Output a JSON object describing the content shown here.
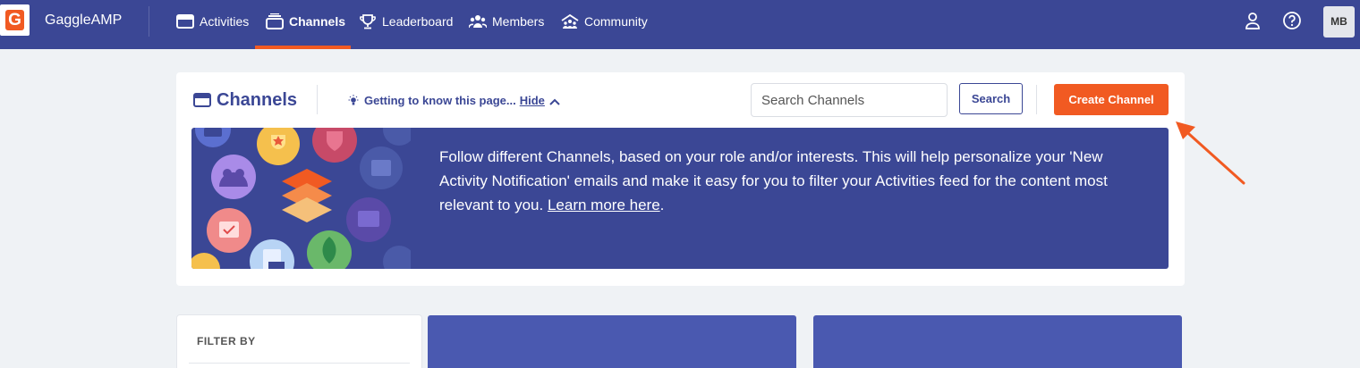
{
  "nav": {
    "brand": "GaggleAMP",
    "items": [
      {
        "label": "Activities",
        "icon": "activities-icon"
      },
      {
        "label": "Channels",
        "icon": "channels-icon",
        "active": true
      },
      {
        "label": "Leaderboard",
        "icon": "trophy-icon"
      },
      {
        "label": "Members",
        "icon": "members-icon"
      },
      {
        "label": "Community",
        "icon": "community-icon"
      }
    ],
    "avatar_initials": "MB"
  },
  "header": {
    "title": "Channels",
    "tip_text": "Getting to know this page...",
    "hide_label": "Hide",
    "search_placeholder": "Search Channels",
    "search_button": "Search",
    "create_button": "Create Channel"
  },
  "banner": {
    "text_before": "Follow different Channels, based on your role and/or interests. This will help personalize your 'New Activity Notification' emails and make it easy for you to filter your Activities feed for the content most relevant to you. ",
    "link_text": "Learn more here",
    "text_after": "."
  },
  "filter": {
    "label": "FILTER BY"
  },
  "colors": {
    "primary": "#3b4795",
    "accent": "#f15a22",
    "background": "#eff2f5",
    "card_blue": "#4a59b0"
  }
}
